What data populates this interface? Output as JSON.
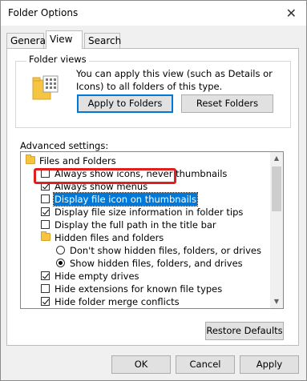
{
  "window": {
    "title": "Folder Options",
    "close_glyph": "✕"
  },
  "tabs": [
    {
      "label": "General",
      "active": false
    },
    {
      "label": "View",
      "active": true
    },
    {
      "label": "Search",
      "active": false
    }
  ],
  "folder_views": {
    "group_label": "Folder views",
    "description": "You can apply this view (such as Details or Icons) to all folders of this type.",
    "apply_button": "Apply to Folders",
    "reset_button": "Reset Folders"
  },
  "advanced": {
    "label": "Advanced settings:",
    "items": [
      {
        "kind": "folder",
        "label": "Files and Folders"
      },
      {
        "kind": "checkbox",
        "checked": false,
        "label": "Always show icons, never thumbnails"
      },
      {
        "kind": "checkbox",
        "checked": true,
        "label": "Always show menus"
      },
      {
        "kind": "checkbox",
        "checked": false,
        "label": "Display file icon on thumbnails",
        "selected": true
      },
      {
        "kind": "checkbox",
        "checked": true,
        "label": "Display file size information in folder tips"
      },
      {
        "kind": "checkbox",
        "checked": false,
        "label": "Display the full path in the title bar"
      },
      {
        "kind": "folder",
        "label": "Hidden files and folders"
      },
      {
        "kind": "radio",
        "checked": false,
        "label": "Don't show hidden files, folders, or drives"
      },
      {
        "kind": "radio",
        "checked": true,
        "label": "Show hidden files, folders, and drives"
      },
      {
        "kind": "checkbox",
        "checked": true,
        "label": "Hide empty drives"
      },
      {
        "kind": "checkbox",
        "checked": false,
        "label": "Hide extensions for known file types"
      },
      {
        "kind": "checkbox",
        "checked": true,
        "label": "Hide folder merge conflicts"
      }
    ],
    "restore_button": "Restore Defaults"
  },
  "footer": {
    "ok": "OK",
    "cancel": "Cancel",
    "apply": "Apply"
  },
  "colors": {
    "accent": "#0078d7",
    "highlight_box": "#e02020",
    "folder": "#f5c542"
  },
  "icons": {
    "scroll_up": "▲",
    "scroll_down": "▼"
  }
}
